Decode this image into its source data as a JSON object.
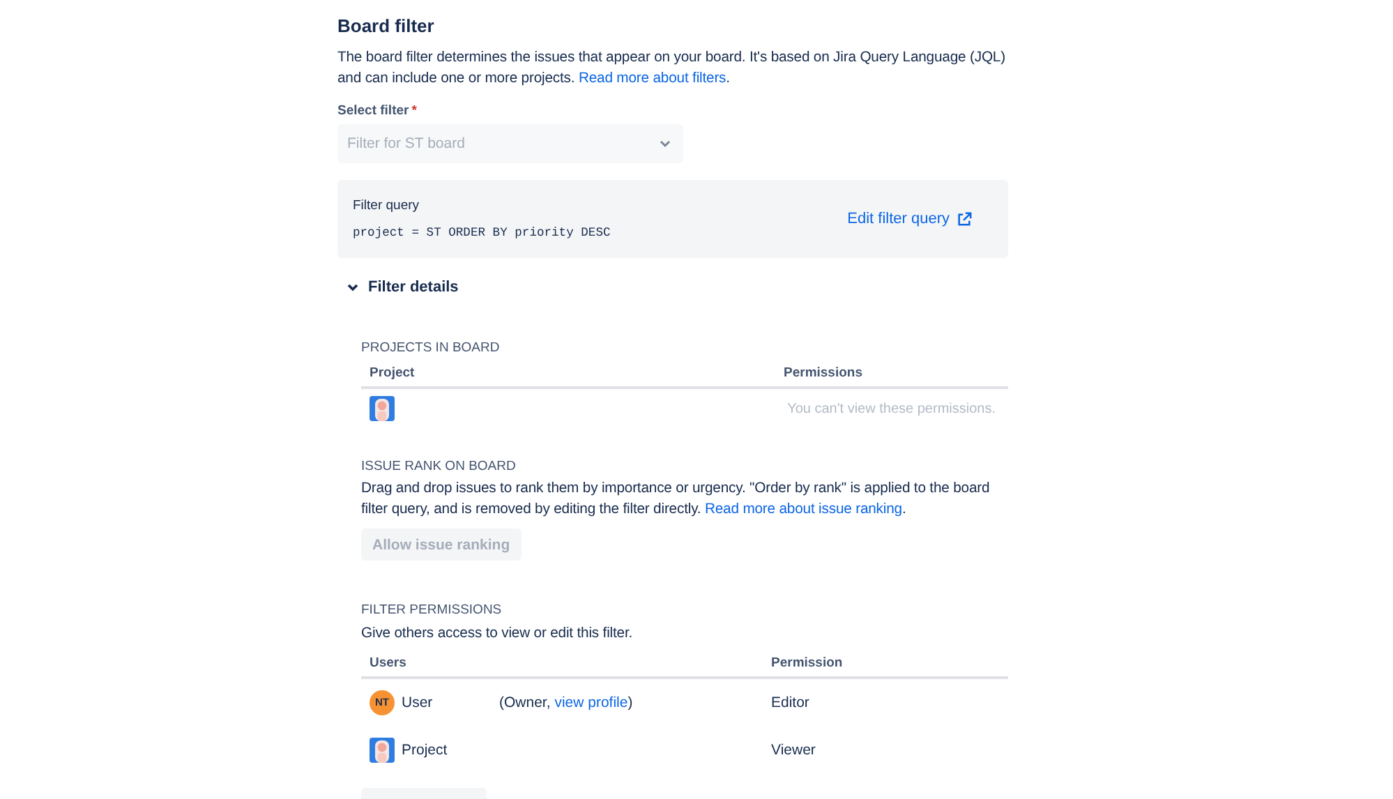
{
  "title": "Board filter",
  "description": {
    "text": "The board filter determines the issues that appear on your board. It's based on Jira Query Language (JQL) and can include one or more projects.",
    "link": "Read more about filters",
    "end": "."
  },
  "select_filter": {
    "label": "Select filter",
    "required_mark": "*",
    "placeholder": "Filter for ST board",
    "disabled": true
  },
  "filter_query": {
    "label": "Filter query",
    "query": "project = ST ORDER BY priority DESC",
    "edit_link": "Edit filter query"
  },
  "filter_details": {
    "label": "Filter details",
    "expanded": true
  },
  "projects_in_board": {
    "heading": "PROJECTS IN BOARD",
    "columns": [
      "Project",
      "Permissions"
    ],
    "rows": [
      {
        "permissions": "You can't view these permissions."
      }
    ]
  },
  "issue_rank": {
    "heading": "ISSUE RANK ON BOARD",
    "text": "Drag and drop issues to rank them by importance or urgency. \"Order by rank\" is applied to the board filter query, and is removed by editing the filter directly.",
    "link": "Read more about issue ranking",
    "end": ".",
    "button": {
      "label": "Allow issue ranking",
      "disabled": true
    }
  },
  "filter_permissions": {
    "heading": "FILTER PERMISSIONS",
    "text": "Give others access to view or edit this filter.",
    "columns": [
      "Users",
      "Permission"
    ],
    "rows": [
      {
        "kind": "user",
        "initials": "NT",
        "name": "User",
        "note": "(Owner, ",
        "note_link": "view profile",
        "note_end": ")",
        "permission": "Editor"
      },
      {
        "kind": "project",
        "name": "Project",
        "permission": "Viewer"
      }
    ]
  }
}
